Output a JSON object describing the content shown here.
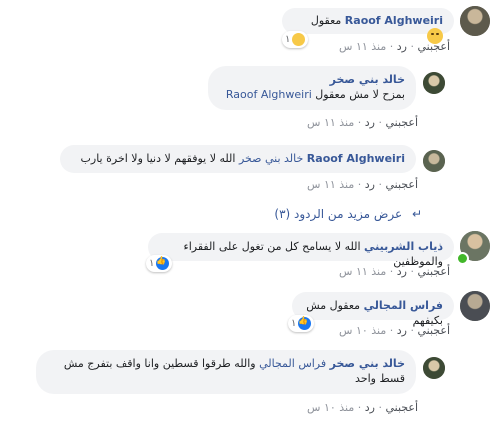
{
  "actions": {
    "like": "أعجبني",
    "reply": "رد",
    "sep": "·"
  },
  "comments": [
    {
      "author": "Raoof Alghweiri",
      "text": "معقول",
      "emoji": "🤔",
      "reactions": "١",
      "time": "منذ ١١ س"
    },
    {
      "author": "خالد بني صخر",
      "text": "بمزح لا مش معقول",
      "mention": "Raoof Alghweiri",
      "time": "منذ ١١ س"
    },
    {
      "author": "Raoof Alghweiri",
      "mention": "خالد بني صخر",
      "text": "الله لا يوفقهم لا دنيا ولا اخرة يارب",
      "time": "منذ ١١ س"
    },
    {
      "more_replies": "عرض مزيد من الردود (٣)"
    },
    {
      "author": "ذياب الشربيني",
      "text": "الله لا يسامح كل من تغول على الفقراء والموظفين",
      "reactions": "١",
      "time": "منذ ١١ س"
    },
    {
      "author": "فراس المجالي",
      "text": "معقول مش بكيفهم",
      "reactions": "١",
      "time": "منذ ١٠ س"
    },
    {
      "author": "خالد بني صخر",
      "mention": "فراس المجالي",
      "text": "والله طرقوا قسطين وانا واقف بتفرج مش قسط واحد",
      "time": "منذ ١٠ س"
    }
  ],
  "colors": {
    "bubble": "#f2f3f5",
    "link": "#385898",
    "meta": "#90949c",
    "like": "#1877f2",
    "online": "#42b72a"
  }
}
